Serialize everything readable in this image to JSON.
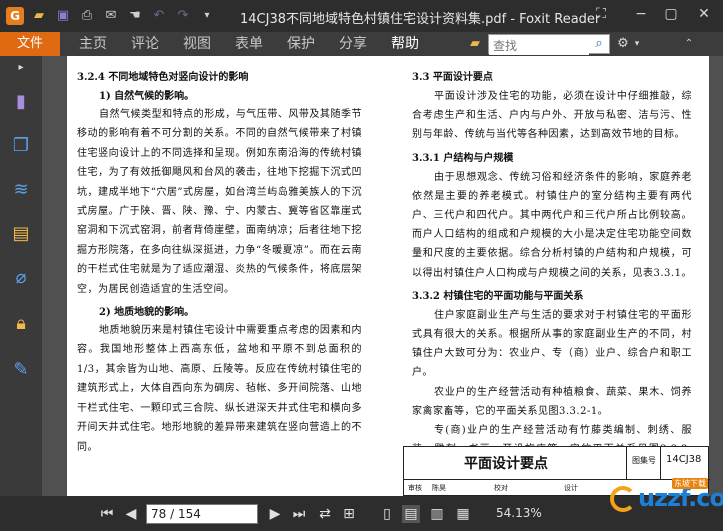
{
  "window": {
    "title": "14CJ38不同地域特色村镇住宅设计资料集.pdf - Foxit Reader",
    "app_logo": "G"
  },
  "ribbon": {
    "file_tab": "文件",
    "tabs": [
      "主页",
      "评论",
      "视图",
      "表单",
      "保护",
      "分享",
      "帮助"
    ],
    "active_tab": "帮助",
    "search_placeholder": "查找"
  },
  "document": {
    "left": {
      "section": "3.2.4   不同地域特色对竖向设计的影响",
      "sub1": "1)   自然气候的影响。",
      "para1": "自然气候类型和特点的形成，与气压带、风带及其随季节移动的影响有着不可分割的关系。不同的自然气候带来了村镇住宅竖向设计上的不同选择和呈现。例如东南沿海的传统村镇住宅，为了有效抵御飓风和台风的袭击，往地下挖掘下沉式凹坑，建成半地下“穴居”式房屋，如台湾兰屿岛雅美族人的下沉式房屋。广于陕、晋、陕、豫、宁、内蒙古、冀等省区靠崖式窑洞和下沉式窑洞，前者背倚崖壁，面南纳凉；后者往地下挖掘方形院落，在多向往纵深挺进，力争“冬暖夏凉”。而在云南的干栏式住宅就是为了适应潮湿、炎热的气候条件，将底层架空，为居民创造适宜的生活空间。",
      "sub2": "2)   地质地貌的影响。",
      "para2": "地质地貌历来是村镇住宅设计中需要重点考虑的因素和内容。我国地形整体上西高东低，盆地和平原不到总面积的1/3，其余皆为山地、高原、丘陵等。反应在传统村镇住宅的建筑形式上，大体自西向东为碉房、毡帐、多开间院落、山地干栏式住宅、一颗印式三合院、纵长进深天井式住宅和横向多开间天井式住宅。地形地貌的差异带来建筑在竖向营造上的不同。"
    },
    "right": {
      "section1": "3.3   平面设计要点",
      "para1": "平面设计涉及住宅的功能，必须在设计中仔细推敲，综合考虑生产和生活、户内与户外、开放与私密、洁与污、性别与年龄、传统与当代等各种因素，达到高效节地的目标。",
      "section2": "3.3.1   户结构与户规模",
      "para2": "由于思想观念、传统习俗和经济条件的影响，家庭养老依然是主要的养老模式。村镇住户的室分结构主要有两代户、三代户和四代户。其中两代户和三代户所占比例较高。而户人口结构的组成和户规模的大小是决定住宅功能空间数量和尺度的主要依据。综合分析村镇的户结构和户规模，可以得出村镇住户人口构成与户规模之间的关系，见表3.3.1。",
      "section3": "3.3.2   村镇住宅的平面功能与平面关系",
      "para3": "住户家庭副业生产与生活的要求对于村镇住宅的平面形式具有很大的关系。根据所从事的家庭副业生产的不同，村镇住户大致可分为：农业户、专（商）业户、综合户和职工户。",
      "para4": "农业户的生产经营活动有种植粮食、蔬菜、果木、饲养家禽家畜等，它的平面关系见图3.3.2-1。",
      "para5": "专(商)业户的生产经营活动有竹藤类编制、刺绣、服装、雕刻、书画、开设旅店等，它的平面关系见图3.3.2-2。"
    },
    "title_block": {
      "title": "平面设计要点",
      "atlas_label": "图集号",
      "atlas_no": "14CJ38",
      "footer": [
        "审核",
        "陈昊",
        "校对",
        "设计"
      ]
    }
  },
  "watermark": {
    "brand": "uzzf.com",
    "tag": "东坡下载"
  },
  "statusbar": {
    "page_display": "78 / 154",
    "zoom": "54.13%"
  }
}
